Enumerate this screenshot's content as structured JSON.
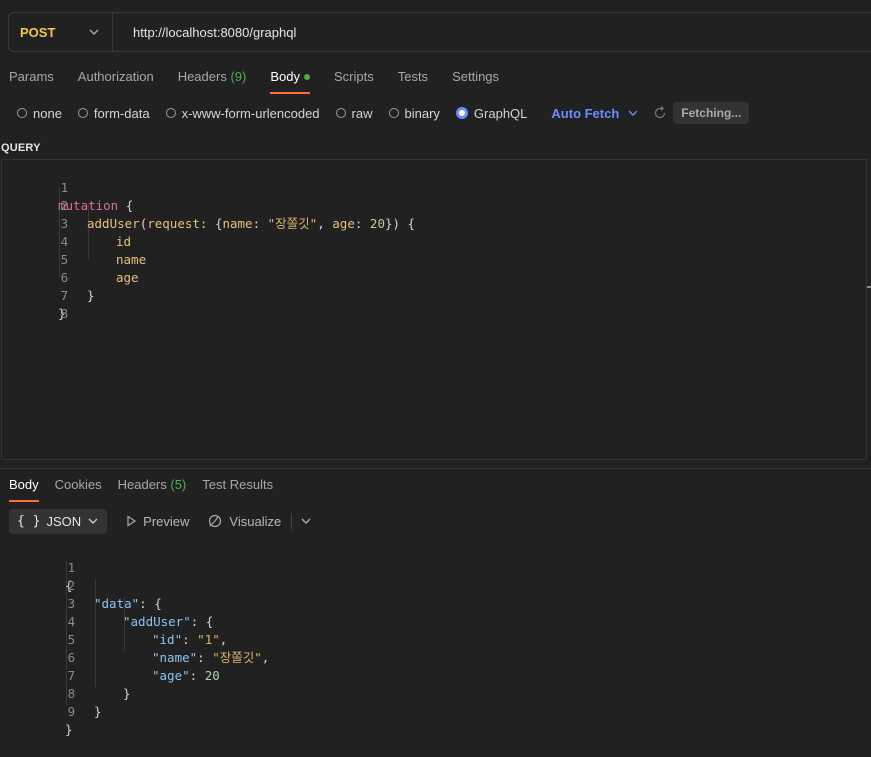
{
  "request": {
    "method": "POST",
    "url": "http://localhost:8080/graphql"
  },
  "request_tabs": [
    {
      "label": "Params"
    },
    {
      "label": "Authorization"
    },
    {
      "label": "Headers",
      "count": "(9)"
    },
    {
      "label": "Body",
      "active": true
    },
    {
      "label": "Scripts"
    },
    {
      "label": "Tests"
    },
    {
      "label": "Settings"
    }
  ],
  "body_types": {
    "none": "none",
    "form_data": "form-data",
    "urlencoded": "x-www-form-urlencoded",
    "raw": "raw",
    "binary": "binary",
    "graphql": "GraphQL",
    "selected": "GraphQL"
  },
  "auto_fetch": "Auto Fetch",
  "fetching": "Fetching...",
  "query_label": "QUERY",
  "query_lines": [
    "1",
    "2",
    "3",
    "4",
    "5",
    "6",
    "7",
    "8"
  ],
  "query_code": {
    "l1_kw": "mutation",
    "l1_brace": " {",
    "l2_fn": "addUser",
    "l2_p1": "(",
    "l2_arg": "request",
    "l2_p2": ": {",
    "l2_k1": "name",
    "l2_p3": ": ",
    "l2_s1": "\"장쫄깃\"",
    "l2_p4": ", ",
    "l2_k2": "age",
    "l2_p5": ": ",
    "l2_n1": "20",
    "l2_p6": "}) {",
    "l3": "id",
    "l4": "name",
    "l5": "age",
    "l6": "}",
    "l7": "}"
  },
  "response_tabs": [
    {
      "label": "Body",
      "active": true
    },
    {
      "label": "Cookies"
    },
    {
      "label": "Headers",
      "count": "(5)"
    },
    {
      "label": "Test Results"
    }
  ],
  "response_toolbar": {
    "braces": "{ }",
    "format": "JSON",
    "preview": "Preview",
    "visualize": "Visualize"
  },
  "response_lines": [
    "1",
    "2",
    "3",
    "4",
    "5",
    "6",
    "7",
    "8",
    "9"
  ],
  "response_code": {
    "l1": "{",
    "l2_key": "\"data\"",
    "l2_p": ": {",
    "l3_key": "\"addUser\"",
    "l3_p": ": {",
    "l4_key": "\"id\"",
    "l4_p": ": ",
    "l4_val": "\"1\"",
    "l4_c": ",",
    "l5_key": "\"name\"",
    "l5_p": ": ",
    "l5_val": "\"장쫄깃\"",
    "l5_c": ",",
    "l6_key": "\"age\"",
    "l6_p": ": ",
    "l6_val": "20",
    "l7": "}",
    "l8": "}",
    "l9": "}"
  },
  "colors": {
    "accent_tab": "#ff6c37",
    "method": "#f2c94c",
    "link": "#6a8dff",
    "count": "#4caf50"
  }
}
